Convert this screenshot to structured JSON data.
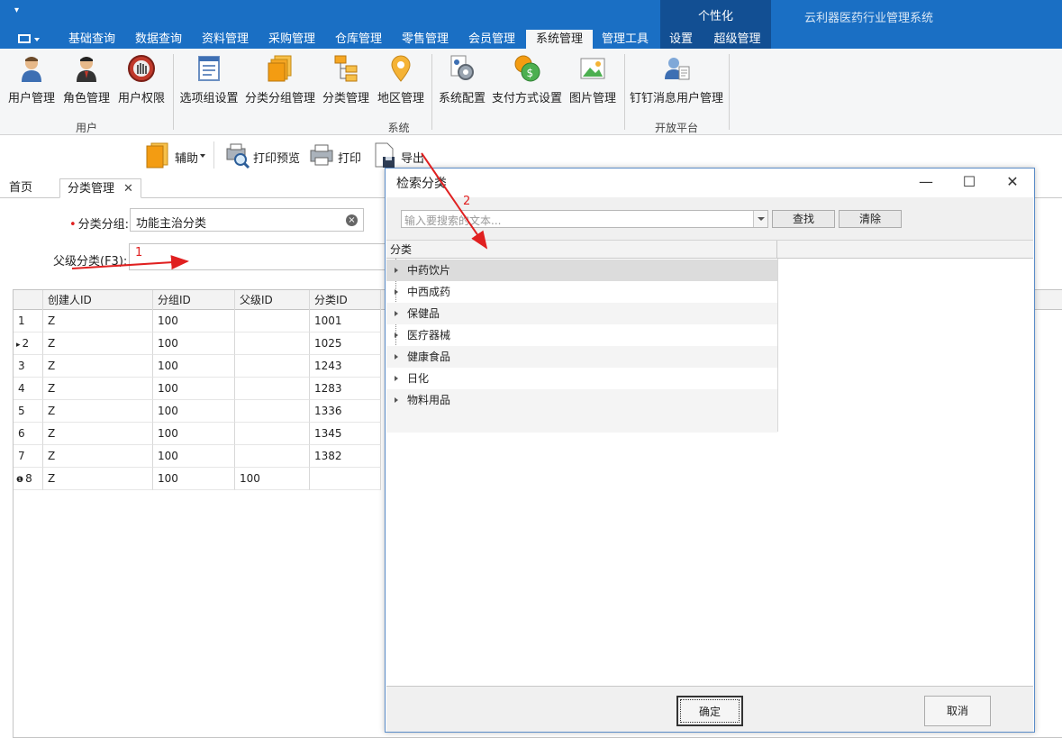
{
  "app": {
    "title": "云利器医药行业管理系统",
    "personalize_label": "个性化",
    "quick_access_glyph": "▾"
  },
  "ribbon_tabs": [
    {
      "label": "基础查询"
    },
    {
      "label": "数据查询"
    },
    {
      "label": "资料管理"
    },
    {
      "label": "采购管理"
    },
    {
      "label": "仓库管理"
    },
    {
      "label": "零售管理"
    },
    {
      "label": "会员管理"
    },
    {
      "label": "系统管理",
      "active": true
    },
    {
      "label": "管理工具"
    },
    {
      "label": "设置"
    },
    {
      "label": "超级管理"
    }
  ],
  "ribbon": {
    "groups": [
      {
        "label": "用户",
        "buttons": [
          {
            "label": "用户管理",
            "icon": "user-icon"
          },
          {
            "label": "角色管理",
            "icon": "role-icon"
          },
          {
            "label": "用户权限",
            "icon": "permission-icon"
          }
        ]
      },
      {
        "label": "系统",
        "buttons": [
          {
            "label": "选项组设置",
            "icon": "option-group-icon"
          },
          {
            "label": "分类分组管理",
            "icon": "category-group-icon"
          },
          {
            "label": "分类管理",
            "icon": "category-tree-icon"
          },
          {
            "label": "地区管理",
            "icon": "location-pin-icon"
          },
          {
            "label": "系统配置",
            "icon": "system-config-icon"
          },
          {
            "label": "支付方式设置",
            "icon": "payment-icon"
          },
          {
            "label": "图片管理",
            "icon": "image-icon"
          }
        ]
      },
      {
        "label": "开放平台",
        "buttons": [
          {
            "label": "钉钉消息用户管理",
            "icon": "dingtalk-user-icon"
          }
        ]
      }
    ]
  },
  "toolbar": {
    "assist_label": "辅助",
    "print_preview_label": "打印预览",
    "print_label": "打印",
    "export_label": "导出"
  },
  "doc_tabs": [
    {
      "label": "首页"
    },
    {
      "label": "分类管理",
      "active": true,
      "closable": true
    }
  ],
  "doc_tab_close_glyph": "✕",
  "form": {
    "category_group_label": "分类分组:",
    "category_group_value": "功能主治分类",
    "parent_category_label": "父级分类(F3):",
    "parent_category_value": "",
    "required_mark": "•"
  },
  "grid": {
    "columns": [
      "创建人ID",
      "分组ID",
      "父级ID",
      "分类ID"
    ],
    "rows": [
      {
        "num": "1",
        "creator": "Z",
        "group": "100",
        "parent": "",
        "cat": "1001",
        "marker": ""
      },
      {
        "num": "2",
        "creator": "Z",
        "group": "100",
        "parent": "",
        "cat": "1025",
        "marker": "▸"
      },
      {
        "num": "3",
        "creator": "Z",
        "group": "100",
        "parent": "",
        "cat": "1243",
        "marker": ""
      },
      {
        "num": "4",
        "creator": "Z",
        "group": "100",
        "parent": "",
        "cat": "1283",
        "marker": ""
      },
      {
        "num": "5",
        "creator": "Z",
        "group": "100",
        "parent": "",
        "cat": "1336",
        "marker": ""
      },
      {
        "num": "6",
        "creator": "Z",
        "group": "100",
        "parent": "",
        "cat": "1345",
        "marker": ""
      },
      {
        "num": "7",
        "creator": "Z",
        "group": "100",
        "parent": "",
        "cat": "1382",
        "marker": ""
      },
      {
        "num": "8",
        "creator": "Z",
        "group": "100",
        "parent": "100",
        "cat": "",
        "marker": "❶"
      }
    ]
  },
  "dialog": {
    "title": "检索分类",
    "search_placeholder": "输入要搜索的文本...",
    "find_label": "查找",
    "clear_label": "清除",
    "tree_header": "分类",
    "nodes": [
      "中药饮片",
      "中西成药",
      "保健品",
      "医疗器械",
      "健康食品",
      "日化",
      "物料用品"
    ],
    "ok_label": "确定",
    "cancel_label": "取消",
    "minimize_glyph": "—",
    "maximize_glyph": "☐",
    "close_glyph": "✕"
  },
  "annotations": {
    "arrow1_label": "1",
    "arrow2_label": "2",
    "color": "#e02020"
  }
}
